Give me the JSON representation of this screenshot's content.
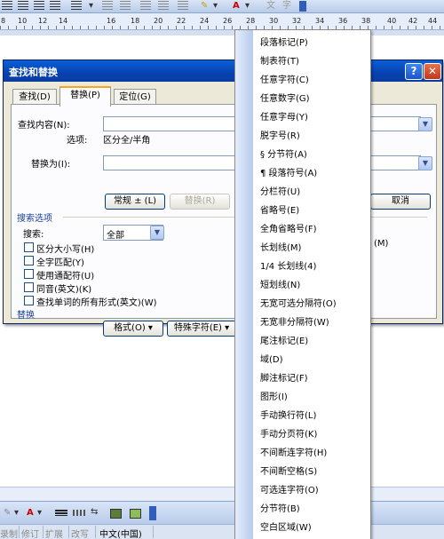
{
  "ruler": {
    "numbers": [
      "8",
      "10",
      "12",
      "14",
      "16",
      "18",
      "20",
      "22",
      "24",
      "26",
      "28",
      "30",
      "32",
      "34",
      "36",
      "38",
      "40",
      "42",
      "44"
    ]
  },
  "dialog": {
    "title": "查找和替换",
    "help": "?",
    "close": "✕",
    "tabs": [
      {
        "label": "查找(D)",
        "active": false
      },
      {
        "label": "替换(P)",
        "active": true
      },
      {
        "label": "定位(G)",
        "active": false
      }
    ],
    "find_label": "查找内容(N):",
    "options_label": "选项:",
    "options_value": "区分全/半角",
    "replace_label": "替换为(I):",
    "btn_normal": "常规 ± (L)",
    "btn_replace": "替换(R)",
    "btn_cancel": "取消",
    "search_options_header": "搜索选项",
    "search_label": "搜索:",
    "search_value": "全部",
    "checkboxes": [
      "区分大小写(H)",
      "全字匹配(Y)",
      "使用通配符(U)",
      "同音(英文)(K)",
      "查找单词的所有形式(英文)(W)"
    ],
    "right_shortcut": "(M)",
    "replace_header": "替换",
    "btn_format": "格式(O) ▾",
    "btn_special": "特殊字符(E) ▾"
  },
  "menu": {
    "items": [
      "段落标记(P)",
      "制表符(T)",
      "任意字符(C)",
      "任意数字(G)",
      "任意字母(Y)",
      "脱字号(R)",
      "§ 分节符(A)",
      "¶ 段落符号(A)",
      "分栏符(U)",
      "省略号(E)",
      "全角省略号(F)",
      "长划线(M)",
      "1/4 长划线(4)",
      "短划线(N)",
      "无宽可选分隔符(O)",
      "无宽非分隔符(W)",
      "尾注标记(E)",
      "域(D)",
      "脚注标记(F)",
      "图形(I)",
      "手动换行符(L)",
      "手动分页符(K)",
      "不间断连字符(H)",
      "不间断空格(S)",
      "可选连字符(O)",
      "分节符(B)",
      "空白区域(W)"
    ]
  },
  "status": {
    "items": [
      "录制",
      "修订",
      "扩展",
      "改写",
      "中文(中国)"
    ]
  }
}
